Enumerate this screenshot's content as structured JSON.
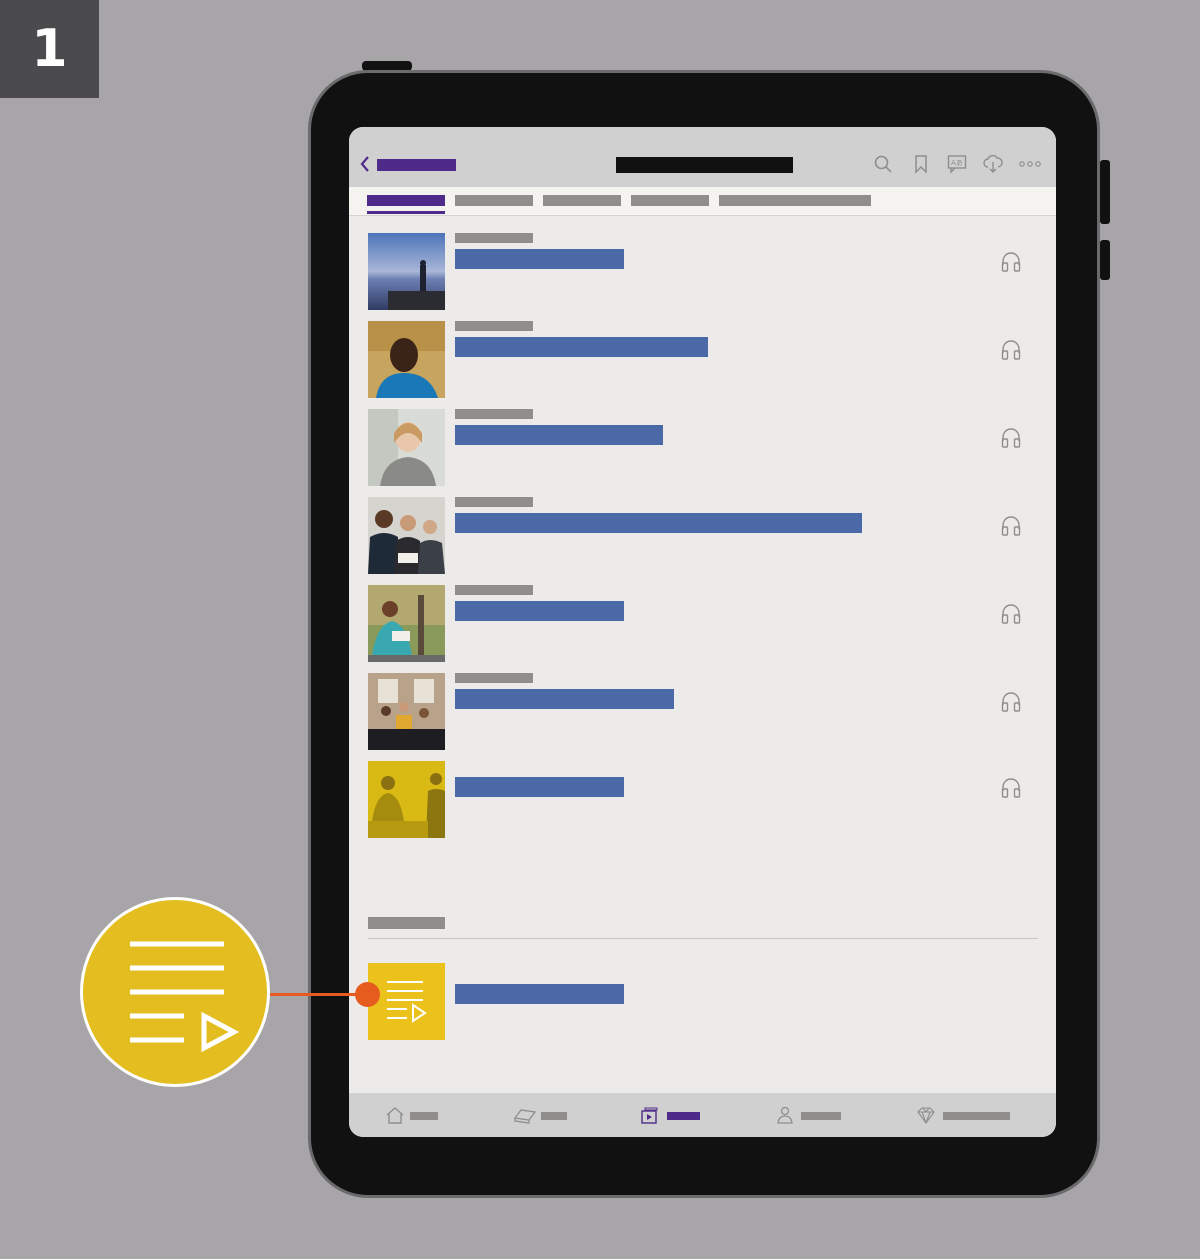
{
  "step": {
    "number": "1"
  },
  "colors": {
    "background": "#a7a5a8",
    "accent_purple": "#4e2a8a",
    "title_blue": "#4a69a6",
    "placeholder_gray": "#8f8e8c",
    "highlight_yellow": "#e4bd20",
    "callout_orange": "#e65c1e"
  },
  "toolbar": {
    "icons": [
      "back-icon",
      "search-icon",
      "bookmark-icon",
      "language-icon",
      "download-icon",
      "more-icon"
    ]
  },
  "tabs": {
    "count": 5,
    "active_index": 0
  },
  "list": {
    "items": [
      {
        "thumbnail": "person-on-rocks-at-sea-image",
        "has_audio": true,
        "has_meta": true
      },
      {
        "thumbnail": "smiling-man-portrait-image",
        "has_audio": true,
        "has_meta": true
      },
      {
        "thumbnail": "woman-reading-image",
        "has_audio": true,
        "has_meta": true
      },
      {
        "thumbnail": "group-reading-image",
        "has_audio": true,
        "has_meta": true
      },
      {
        "thumbnail": "woman-studying-outdoors-image",
        "has_audio": true,
        "has_meta": true
      },
      {
        "thumbnail": "classroom-image",
        "has_audio": true,
        "has_meta": true
      },
      {
        "thumbnail": "yellow-tinted-people-image",
        "has_audio": true,
        "has_meta": false
      }
    ]
  },
  "playlist": {
    "icon": "playlist-icon"
  },
  "bottom_nav": {
    "items": [
      "home-icon",
      "bible-icon",
      "media-icon",
      "meetings-icon",
      "personal-study-icon"
    ],
    "active_index": 2
  },
  "callout": {
    "icon": "playlist-icon"
  }
}
